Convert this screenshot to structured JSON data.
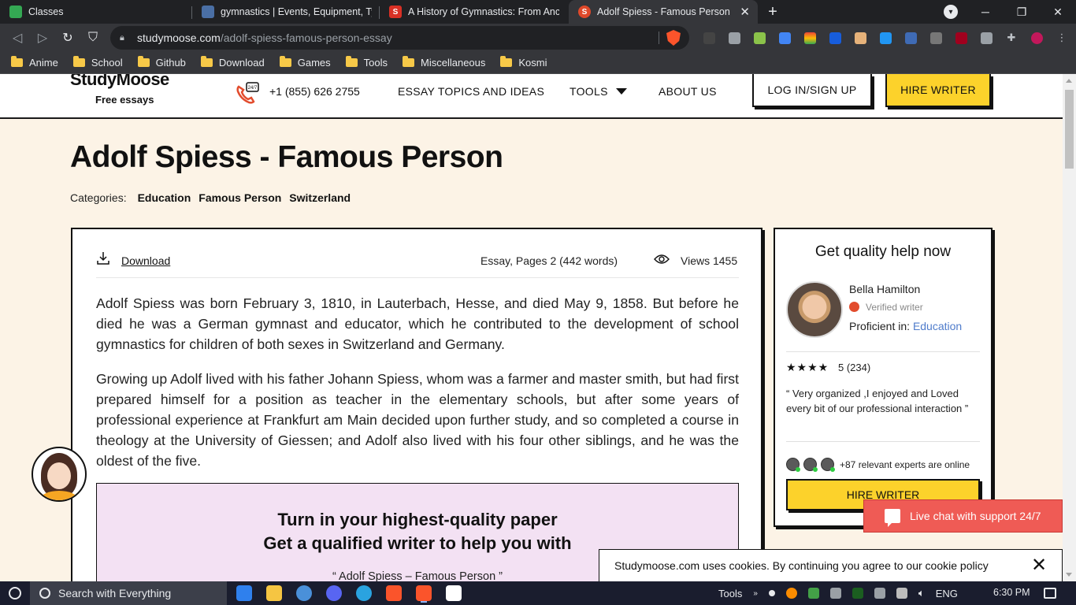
{
  "browser": {
    "tabs": [
      {
        "title": "Classes",
        "favicon_color": "#34a853",
        "active": false
      },
      {
        "title": "gymnastics | Events, Equipment, Types",
        "favicon_color": "#4a6fa5",
        "active": false
      },
      {
        "title": "A History of Gymnastics: From Ancient",
        "favicon_color": "#d93025",
        "active": false
      },
      {
        "title": "Adolf Spiess - Famous Person Free",
        "favicon_color": "#e0492a",
        "active": true
      }
    ],
    "new_tab": "+",
    "url_domain": "studymoose.com",
    "url_path": "/adolf-spiess-famous-person-essay",
    "bookmarks": [
      "Anime",
      "School",
      "Github",
      "Download",
      "Games",
      "Tools",
      "Miscellaneous",
      "Kosmi"
    ]
  },
  "site": {
    "logo": "StudyMoose",
    "logo_sub": "Free essays",
    "phone": "+1 (855) 626 2755",
    "nav": {
      "topics": "ESSAY TOPICS AND IDEAS",
      "tools": "TOOLS",
      "about": "ABOUT US",
      "login": "LOG IN/SIGN UP",
      "hire": "HIRE WRITER"
    }
  },
  "article": {
    "title": "Adolf Spiess - Famous Person",
    "categories_label": "Categories:",
    "categories": [
      "Education",
      "Famous Person",
      "Switzerland"
    ],
    "download": "Download",
    "essay_meta": "Essay, Pages 2 (442 words)",
    "views_label": "Views",
    "views": "1455",
    "paragraphs": [
      "Adolf Spiess was born February 3, 1810, in Lauterbach, Hesse, and died May 9, 1858. But before he died he was a German gymnast and educator, which he contributed to the development of school gymnastics for children of both sexes in Switzerland and Germany.",
      "Growing up Adolf lived with his father Johann Spiess, whom was a farmer and master smith, but had first prepared himself for a position as teacher in the elementary schools, but after some years of professional experience at Frankfurt am Main decided upon further study, and so completed a course in theology at the University of Giessen; and Adolf also lived with his four other siblings, and he was the oldest of the five."
    ],
    "cta": {
      "line1": "Turn in your highest-quality paper",
      "line2": "Get a qualified writer to help you with",
      "topic": "“ Adolf Spiess – Famous Person ”"
    }
  },
  "sidebar": {
    "title": "Get quality help now",
    "writer_name": "Bella Hamilton",
    "verified": "Verified writer",
    "proficient_label": "Proficient in:",
    "proficient_subject": "Education",
    "stars": "★★★★",
    "rating": "5 (234)",
    "review": "“ Very organized ,I enjoyed and Loved every bit of our professional interaction ”",
    "experts_online": "+87 relevant experts are online",
    "hire_button": "HIRE WRITER"
  },
  "overlays": {
    "live_chat": "Live chat  with support 24/7",
    "cookie_text": "Studymoose.com uses cookies. By continuing you agree to our cookie policy",
    "cookie_close": "✕"
  },
  "taskbar": {
    "search_placeholder": "Search with Everything",
    "tools_label": "Tools",
    "lang": "ENG",
    "time": "6:30 PM"
  }
}
